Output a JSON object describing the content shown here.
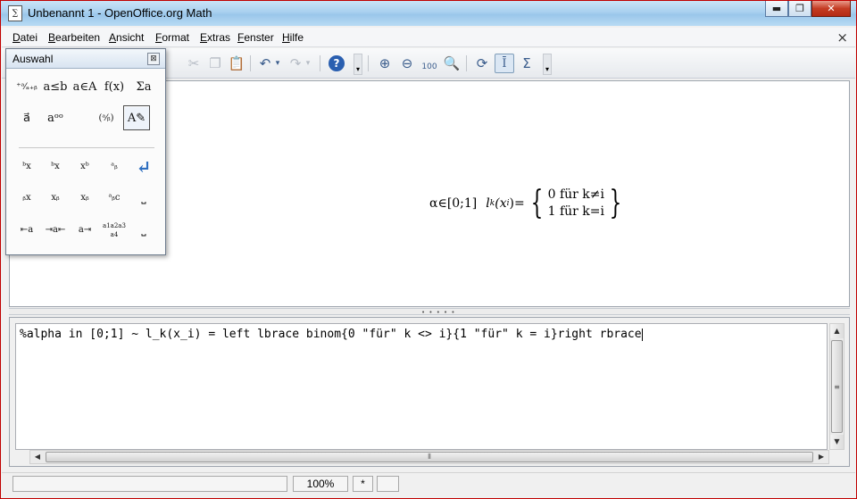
{
  "window": {
    "title": "Unbenannt 1 - OpenOffice.org Math",
    "minimize": "▬",
    "maximize": "❐",
    "close": "✕"
  },
  "menu": {
    "items": [
      "Datei",
      "Bearbeiten",
      "Ansicht",
      "Format",
      "Extras",
      "Fenster",
      "Hilfe"
    ],
    "close_doc": "×"
  },
  "toolbar": {
    "zoom_100_label": "100"
  },
  "palette": {
    "title": "Auswahl",
    "close": "⊠",
    "categories": [
      {
        "label": "⁺ᵃ⁄ₐ₊ᵦ",
        "icon": "unary-binary-operators-icon"
      },
      {
        "label": "a≤b",
        "icon": "relations-icon"
      },
      {
        "label": "a∈A",
        "icon": "set-operations-icon"
      },
      {
        "label": "f(x)",
        "icon": "functions-icon"
      },
      {
        "label": "Σa",
        "icon": "operators-icon"
      },
      {
        "label": "a⃗",
        "icon": "attributes-icon"
      },
      {
        "label": "aᵒᵒ",
        "icon": "others-icon"
      },
      {
        "label": "(ᵃ⁄ᵦ)",
        "icon": "brackets-icon"
      },
      {
        "label": "A✎",
        "icon": "formats-icon"
      }
    ],
    "formats": [
      {
        "label": "ᵇx",
        "icon": "left-superscript-icon"
      },
      {
        "label": "ᵇx",
        "icon": "upper-limit-icon"
      },
      {
        "label": "xᵇ",
        "icon": "superscript-icon"
      },
      {
        "label": "ᵃᵦ",
        "icon": "vertical-stack-icon"
      },
      {
        "label": "↵",
        "icon": "new-line-icon"
      },
      {
        "label": "ᵦx",
        "icon": "left-subscript-icon"
      },
      {
        "label": "xᵦ",
        "icon": "lower-limit-icon"
      },
      {
        "label": "xᵦ",
        "icon": "subscript-icon"
      },
      {
        "label": "ᵃᵦc",
        "icon": "vertical-stack-3-icon"
      },
      {
        "label": "⎵",
        "icon": "small-gap-icon"
      },
      {
        "label": "⇤a",
        "icon": "align-left-icon"
      },
      {
        "label": "⇥a⇤",
        "icon": "align-center-icon"
      },
      {
        "label": "a⇥",
        "icon": "align-right-icon"
      },
      {
        "label": "a1a2a3a4",
        "icon": "matrix-stack-icon"
      },
      {
        "label": "⎵",
        "icon": "gap-icon"
      }
    ]
  },
  "formula": {
    "alpha_part": "α∈[0;1]",
    "lhs": "l",
    "lhs_sub": "k",
    "arg_open": "(x",
    "arg_sub": "i",
    "arg_close": ")=",
    "case1": "0 für k≠i",
    "case2": "1 für k=i"
  },
  "editor": {
    "text": "%alpha in [0;1] ~ l_k(x_i) = left lbrace binom{0 \"für\" k <> i}{1 \"für\" k = i}right rbrace"
  },
  "status": {
    "zoom": "100%",
    "modified": "*"
  }
}
